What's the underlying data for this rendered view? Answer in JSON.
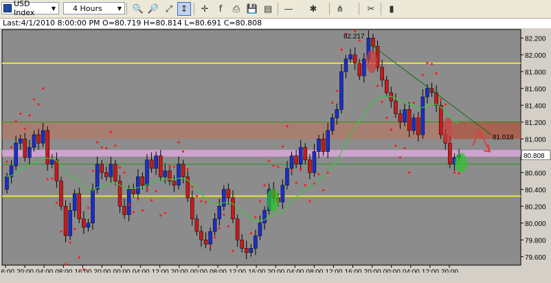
{
  "toolbar": {
    "symbol": "USD Index",
    "timeframe": "4 Hours",
    "buttons": [
      {
        "name": "zoom-in-button",
        "icon": "🔍"
      },
      {
        "name": "zoom-out-button",
        "icon": "🔎"
      },
      {
        "name": "zoom-fit-button",
        "icon": "⤢"
      },
      {
        "name": "cursor-tool-button",
        "icon": "↕"
      },
      {
        "name": "crosshair-button",
        "icon": "✛"
      },
      {
        "name": "indicator-fx-button",
        "icon": "f"
      },
      {
        "name": "print-button",
        "icon": "⎙"
      },
      {
        "name": "save-button",
        "icon": "💾"
      },
      {
        "name": "template-button",
        "icon": "▤"
      },
      {
        "name": "line-tool-button",
        "icon": "—"
      },
      {
        "name": "objects-button",
        "icon": "✱"
      },
      {
        "name": "pitchfork-button",
        "icon": "⋔"
      },
      {
        "name": "settings-button",
        "icon": "✂"
      },
      {
        "name": "candle-style-button",
        "icon": "▮"
      }
    ]
  },
  "info": "Last:4/1/2010 8:00:00 PM O=80.719 H=80.814 L=80.691 C=80.808",
  "chart_data": {
    "type": "candlestick",
    "price_labels": [
      "82.200",
      "82.000",
      "81.800",
      "81.600",
      "81.400",
      "81.200",
      "81.000",
      "80.800",
      "80.600",
      "80.400",
      "80.200",
      "80.000",
      "79.800",
      "79.600"
    ],
    "time_labels": [
      "16:00",
      "20:00",
      "04:00",
      "08:00",
      "16:00",
      "20:00",
      "00:00",
      "04:00",
      "12:00",
      "20:00",
      "00:00",
      "08:00",
      "12:00",
      "16:00",
      "20:00",
      "04:00",
      "08:00",
      "12:00",
      "16:00",
      "20:00",
      "00:00",
      "04:00",
      "12:00",
      "20:00"
    ],
    "ylim": [
      79.5,
      82.3
    ],
    "last_price": "80.808",
    "annotations": [
      {
        "text": "82.217",
        "price": 82.217
      },
      {
        "text": "81.018",
        "price": 81.018
      }
    ],
    "horizontal_lines": [
      {
        "price": 81.9,
        "color": "#e6e63c",
        "kind": "yellow"
      },
      {
        "price": 80.32,
        "color": "#e6e63c",
        "kind": "yellow"
      },
      {
        "price": 81.2,
        "color": "#1e9b1e",
        "kind": "green"
      },
      {
        "price": 80.7,
        "color": "#1e9b1e",
        "kind": "green"
      }
    ],
    "colors": {
      "background": "#8c8c8c",
      "bull": "#1a2ec8",
      "bear": "#c81a1a",
      "sar": "#ff1a1a",
      "ma": "#3cc83c",
      "trend": "#0a6e0a"
    }
  }
}
